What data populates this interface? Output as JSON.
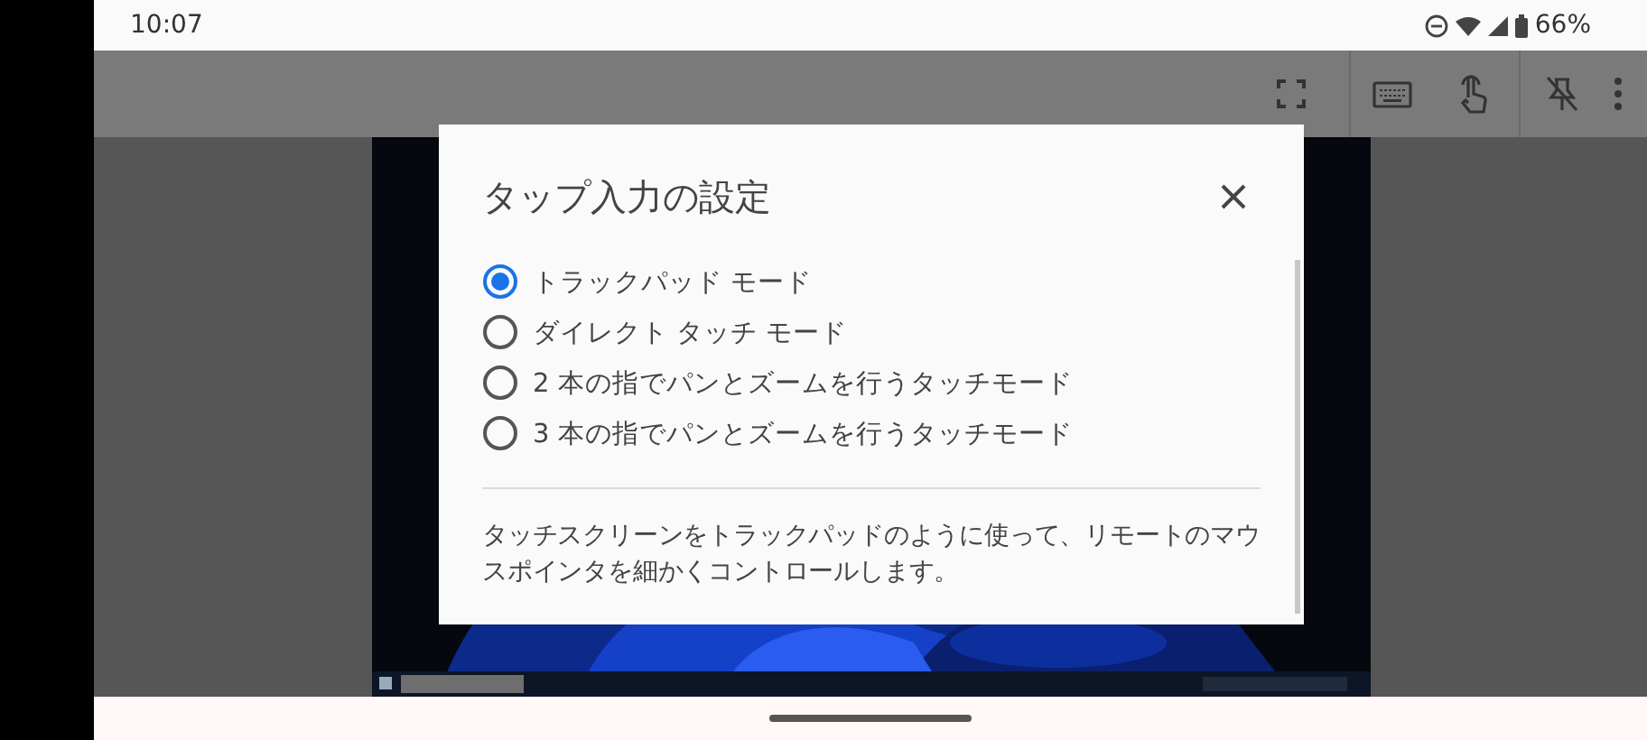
{
  "status_bar": {
    "time": "10:07",
    "battery": "66%"
  },
  "dialog": {
    "title": "タップ入力の設定",
    "options": [
      {
        "label": "トラックパッド モード",
        "selected": true
      },
      {
        "label": "ダイレクト タッチ モード",
        "selected": false
      },
      {
        "label": "2 本の指でパンとズームを行うタッチモード",
        "selected": false
      },
      {
        "label": "3 本の指でパンとズームを行うタッチモード",
        "selected": false
      }
    ],
    "description": "タッチスクリーンをトラックパッドのように使って、リモートのマウスポインタを細かくコントロールします。"
  }
}
